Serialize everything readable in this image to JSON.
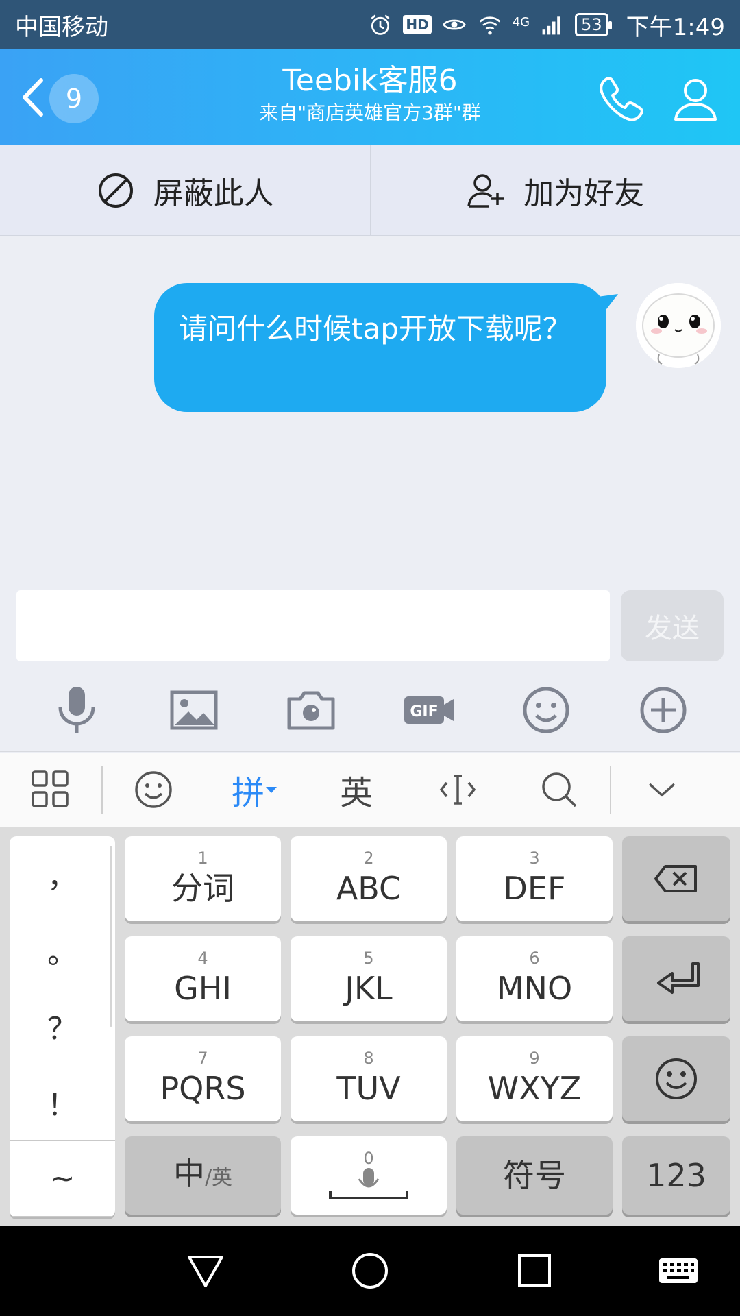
{
  "status_bar": {
    "carrier": "中国移动",
    "hd": "HD",
    "network": "4G",
    "battery": "53",
    "time": "下午1:49"
  },
  "header": {
    "unread_count": "9",
    "title": "Teebik客服6",
    "subtitle": "来自\"商店英雄官方3群\"群"
  },
  "actions": {
    "block_label": "屏蔽此人",
    "add_friend_label": "加为好友"
  },
  "messages": [
    {
      "text": "请问什么时候tap开放下载呢？",
      "from": "self"
    }
  ],
  "composer": {
    "value": "",
    "send_label": "发送"
  },
  "ime": {
    "pinyin_label": "拼",
    "english_label": "英"
  },
  "keyboard": {
    "punctuation": [
      "，",
      "。",
      "？",
      "！",
      "~"
    ],
    "keys": [
      {
        "num": "1",
        "label": "分词"
      },
      {
        "num": "2",
        "label": "ABC"
      },
      {
        "num": "3",
        "label": "DEF"
      },
      {
        "num": "4",
        "label": "GHI"
      },
      {
        "num": "5",
        "label": "JKL"
      },
      {
        "num": "6",
        "label": "MNO"
      },
      {
        "num": "7",
        "label": "PQRS"
      },
      {
        "num": "8",
        "label": "TUV"
      },
      {
        "num": "9",
        "label": "WXYZ"
      }
    ],
    "lang_toggle_main": "中",
    "lang_toggle_sub": "/英",
    "space_num": "0",
    "symbols_label": "符号",
    "numbers_label": "123"
  },
  "colors": {
    "status_bar": "#2f5577",
    "title_bar": "#2ab8f6",
    "bubble": "#1eaaf1",
    "ime_accent": "#2b8af7"
  }
}
